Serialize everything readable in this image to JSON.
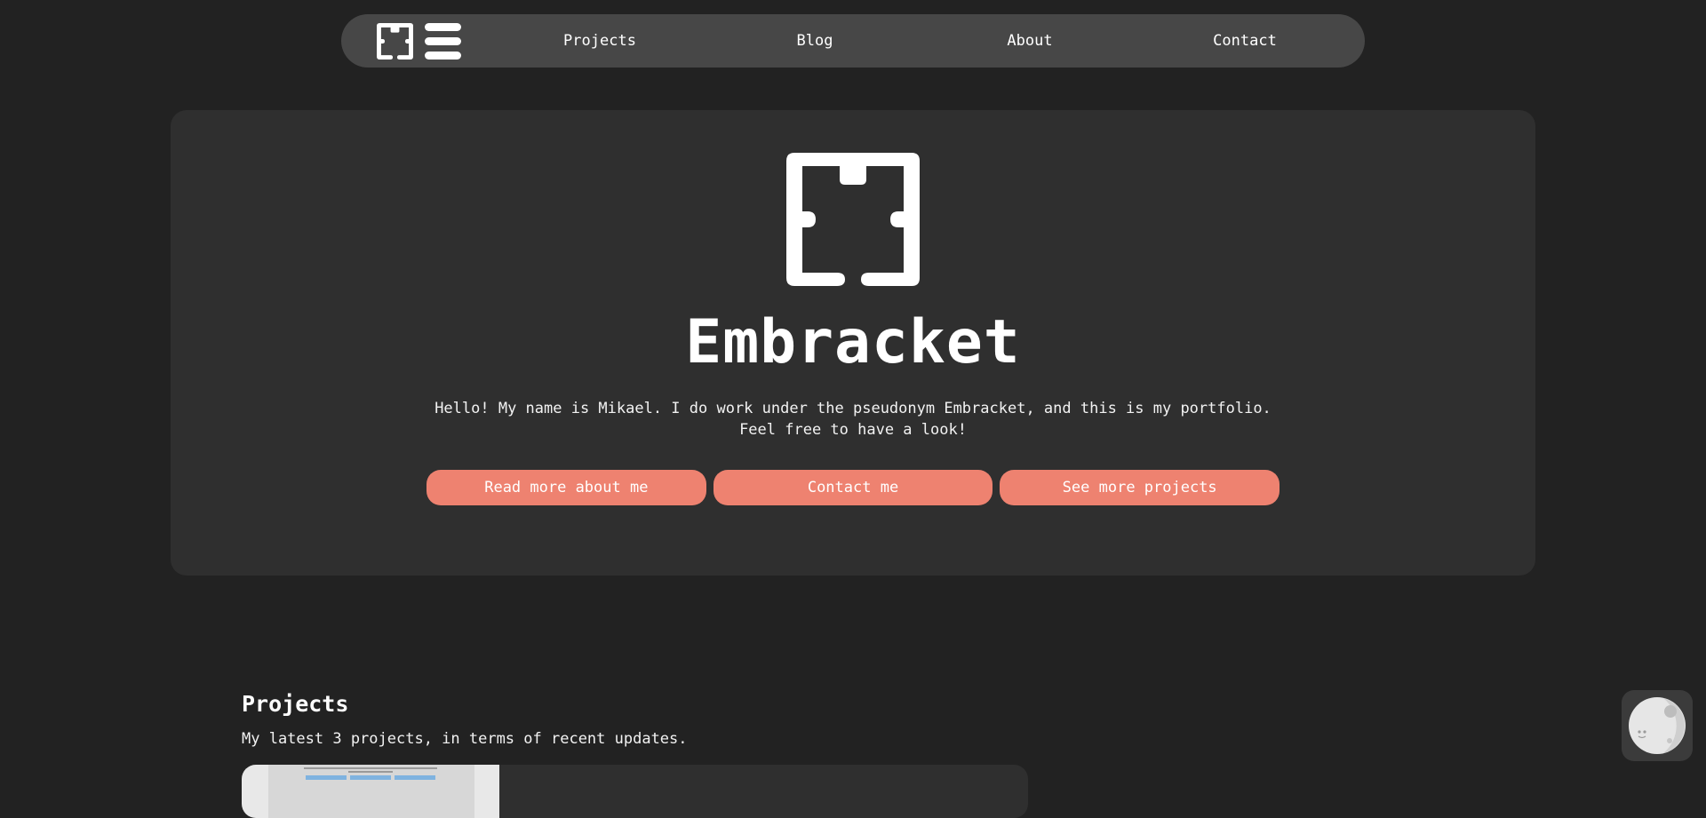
{
  "nav": {
    "logo_icon": "embracket-logo-icon",
    "menu_icon": "hamburger-menu-icon",
    "links": [
      "Projects",
      "Blog",
      "About",
      "Contact"
    ]
  },
  "hero": {
    "logo_icon": "embracket-logo-icon",
    "title": "Embracket",
    "text": "Hello! My name is Mikael. I do work under the pseudonym Embracket, and this is my portfolio. Feel free to have a look!",
    "buttons": [
      "Read more about me",
      "Contact me",
      "See more projects"
    ]
  },
  "projects": {
    "title": "Projects",
    "subtitle": "My latest 3 projects, in terms of recent updates."
  },
  "theme_toggle": {
    "icon": "moon-icon"
  },
  "colors": {
    "background": "#222222",
    "surface": "#2f2f2f",
    "nav": "#474747",
    "accent": "#ee8270",
    "text": "#ffffff"
  }
}
